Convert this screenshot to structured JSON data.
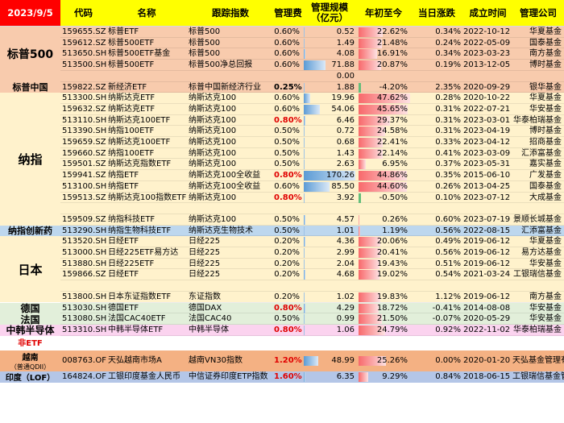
{
  "header": {
    "date": "2023/9/5",
    "columns": [
      "代码",
      "名称",
      "跟踪指数",
      "管理费",
      "管理规模\n（亿元）",
      "年初至今",
      "当日涨跌",
      "成立时间",
      "管理公司"
    ]
  },
  "groups": [
    {
      "label": "标普500",
      "color": "#f8cbad",
      "font": 14,
      "rows": [
        {
          "code": "159655.SZ",
          "name": "标普ETF",
          "index": "标普500",
          "fee": "0.60%",
          "scale": "0.52",
          "ytd": "22.62%",
          "day": "0.34%",
          "date": "2022-10-12",
          "company": "华夏基金"
        },
        {
          "code": "159612.SZ",
          "name": "标普500ETF",
          "index": "标普500",
          "fee": "0.60%",
          "scale": "1.49",
          "ytd": "21.48%",
          "day": "0.24%",
          "date": "2022-05-09",
          "company": "国泰基金"
        },
        {
          "code": "513650.SH",
          "name": "标普500ETF基金",
          "index": "标普500",
          "fee": "0.60%",
          "scale": "4.08",
          "ytd": "16.91%",
          "day": "0.34%",
          "date": "2023-03-23",
          "company": "南方基金"
        },
        {
          "code": "513500.SH",
          "name": "标普500ETF",
          "index": "标普500净总回报",
          "fee": "0.60%",
          "scale": "71.88",
          "ytd": "20.87%",
          "day": "0.19%",
          "date": "2013-12-05",
          "company": "博时基金"
        },
        {
          "code": "",
          "name": "",
          "index": "",
          "fee": "",
          "scale": "0.00",
          "ytd": "",
          "day": "",
          "date": "",
          "company": ""
        }
      ]
    },
    {
      "label": "标普中国",
      "color": "#f8cbad",
      "font": 11,
      "rows": [
        {
          "code": "159822.SZ",
          "name": "新经济ETF",
          "index": "标普中国新经济行业",
          "fee": "0.25%",
          "fee_bold": true,
          "scale": "1.88",
          "ytd": "-4.20%",
          "day": "2.35%",
          "date": "2020-09-29",
          "company": "银华基金"
        }
      ]
    },
    {
      "label": "纳指",
      "color": "#fff2cc",
      "font": 15,
      "rows": [
        {
          "code": "513300.SH",
          "name": "纳斯达克ETF",
          "index": "纳斯达克100",
          "fee": "0.60%",
          "scale": "19.96",
          "ytd": "47.62%",
          "day": "0.28%",
          "date": "2020-10-22",
          "company": "华夏基金"
        },
        {
          "code": "159632.SZ",
          "name": "纳斯达克ETF",
          "index": "纳斯达克100",
          "fee": "0.60%",
          "scale": "54.06",
          "ytd": "45.65%",
          "day": "0.31%",
          "date": "2022-07-21",
          "company": "华安基金"
        },
        {
          "code": "513110.SH",
          "name": "纳斯达克100ETF",
          "index": "纳斯达克100",
          "fee": "0.80%",
          "fee_red": true,
          "scale": "6.46",
          "ytd": "29.37%",
          "day": "0.31%",
          "date": "2023-03-01",
          "company": "华泰柏瑞基金"
        },
        {
          "code": "513390.SH",
          "name": "纳指100ETF",
          "index": "纳斯达克100",
          "fee": "0.50%",
          "scale": "0.72",
          "ytd": "24.58%",
          "day": "0.31%",
          "date": "2023-04-19",
          "company": "博时基金"
        },
        {
          "code": "159659.SZ",
          "name": "纳斯达克100ETF",
          "index": "纳斯达克100",
          "fee": "0.50%",
          "scale": "0.68",
          "ytd": "22.41%",
          "day": "0.33%",
          "date": "2023-04-12",
          "company": "招商基金"
        },
        {
          "code": "159660.SZ",
          "name": "纳指100ETF",
          "index": "纳斯达克100",
          "fee": "0.50%",
          "scale": "1.43",
          "ytd": "22.14%",
          "day": "0.41%",
          "date": "2023-03-09",
          "company": "汇添富基金"
        },
        {
          "code": "159501.SZ",
          "name": "纳斯达克指数ETF",
          "index": "纳斯达克100",
          "fee": "0.50%",
          "scale": "2.63",
          "ytd": "6.95%",
          "day": "0.37%",
          "date": "2023-05-31",
          "company": "嘉实基金"
        },
        {
          "code": "159941.SZ",
          "name": "纳指ETF",
          "index": "纳斯达克100全收益",
          "fee": "0.80%",
          "fee_red": true,
          "scale": "170.26",
          "ytd": "44.86%",
          "day": "0.35%",
          "date": "2015-06-10",
          "company": "广发基金"
        },
        {
          "code": "513100.SH",
          "name": "纳指ETF",
          "index": "纳斯达克100全收益",
          "fee": "0.60%",
          "scale": "85.50",
          "ytd": "44.60%",
          "day": "0.26%",
          "date": "2013-04-25",
          "company": "国泰基金"
        },
        {
          "code": "159513.SZ",
          "name": "纳斯达克100指数ETF",
          "index": "纳斯达克100",
          "fee": "0.80%",
          "fee_red": true,
          "scale": "3.92",
          "ytd": "-0.50%",
          "day": "0.10%",
          "date": "2023-07-12",
          "company": "大成基金"
        },
        {
          "code": "",
          "name": "",
          "index": "",
          "fee": "",
          "scale": "",
          "ytd": "",
          "day": "",
          "date": "",
          "company": ""
        },
        {
          "code": "159509.SZ",
          "name": "纳指科技ETF",
          "index": "纳斯达克100",
          "fee": "0.50%",
          "scale": "4.57",
          "ytd": "0.26%",
          "day": "0.60%",
          "date": "2023-07-19",
          "company": "景顺长城基金"
        }
      ]
    },
    {
      "label": "纳指创新药",
      "color": "#bdd7ee",
      "font": 11,
      "rows": [
        {
          "code": "513290.SH",
          "name": "纳指生物科技ETF",
          "index": "纳斯达克生物技术",
          "fee": "0.50%",
          "scale": "1.01",
          "ytd": "1.19%",
          "day": "0.56%",
          "date": "2022-08-15",
          "company": "汇添富基金"
        }
      ]
    },
    {
      "label": "日本",
      "color": "#fff2cc",
      "font": 15,
      "rows": [
        {
          "code": "513520.SH",
          "name": "日经ETF",
          "index": "日经225",
          "fee": "0.20%",
          "scale": "4.36",
          "ytd": "20.06%",
          "day": "0.49%",
          "date": "2019-06-12",
          "company": "华夏基金"
        },
        {
          "code": "513000.SH",
          "name": "日经225ETF易方达",
          "index": "日经225",
          "fee": "0.20%",
          "scale": "2.99",
          "ytd": "20.41%",
          "day": "0.56%",
          "date": "2019-06-12",
          "company": "易方达基金"
        },
        {
          "code": "513880.SH",
          "name": "日经225ETF",
          "index": "日经225",
          "fee": "0.20%",
          "scale": "2.04",
          "ytd": "19.43%",
          "day": "0.51%",
          "date": "2019-06-12",
          "company": "华安基金"
        },
        {
          "code": "159866.SZ",
          "name": "日经ETF",
          "index": "日经225",
          "fee": "0.20%",
          "scale": "4.68",
          "ytd": "19.02%",
          "day": "0.54%",
          "date": "2021-03-24",
          "company": "工银瑞信基金"
        },
        {
          "code": "",
          "name": "",
          "index": "",
          "fee": "",
          "scale": "",
          "ytd": "",
          "day": "",
          "date": "",
          "company": ""
        },
        {
          "code": "513800.SH",
          "name": "日本东证指数ETF",
          "index": "东证指数",
          "fee": "0.20%",
          "scale": "1.02",
          "ytd": "19.83%",
          "day": "1.12%",
          "date": "2019-06-12",
          "company": "南方基金"
        }
      ]
    },
    {
      "label": "德国",
      "color": "#e2efda",
      "font": 12,
      "rows": [
        {
          "code": "513030.SH",
          "name": "德国ETF",
          "index": "德国DAX",
          "fee": "0.80%",
          "fee_red": true,
          "scale": "4.29",
          "ytd": "18.72%",
          "day": "-0.41%",
          "date": "2014-08-08",
          "company": "华安基金"
        }
      ]
    },
    {
      "label": "法国",
      "color": "#e2efda",
      "font": 12,
      "rows": [
        {
          "code": "513080.SH",
          "name": "法国CAC40ETF",
          "index": "法国CAC40",
          "fee": "0.50%",
          "scale": "0.99",
          "ytd": "21.50%",
          "day": "-0.07%",
          "date": "2020-05-29",
          "company": "华安基金"
        }
      ]
    },
    {
      "label": "中韩半导体",
      "color": "#fbd3ef",
      "font": 12,
      "rows": [
        {
          "code": "513310.SH",
          "name": "中韩半导体ETF",
          "index": "中韩半导体",
          "fee": "0.80%",
          "fee_red": true,
          "scale": "1.06",
          "ytd": "24.79%",
          "day": "0.92%",
          "date": "2022-11-02",
          "company": "华泰柏瑞基金"
        }
      ]
    }
  ],
  "non_etf": {
    "label": "非ETF",
    "rows": [
      {
        "label": "越南",
        "sub": "（普通QDII）",
        "color": "#f4b183",
        "code": "008763.OF",
        "name": "天弘越南市场A",
        "index": "越南VN30指数",
        "fee": "1.20%",
        "scale": "48.99",
        "ytd": "25.26%",
        "day": "0.00%",
        "date": "2020-01-20",
        "company": "天弘基金管理有"
      },
      {
        "label": "印度（LOF）",
        "color": "#b4c6e7",
        "code": "164824.OF",
        "name": "工银印度基金人民币",
        "index": "中信证券印度ETP指数",
        "fee": "1.60%",
        "scale": "6.35",
        "ytd": "9.29%",
        "day": "0.84%",
        "date": "2018-06-15",
        "company": "工银瑞信基金管"
      }
    ]
  }
}
